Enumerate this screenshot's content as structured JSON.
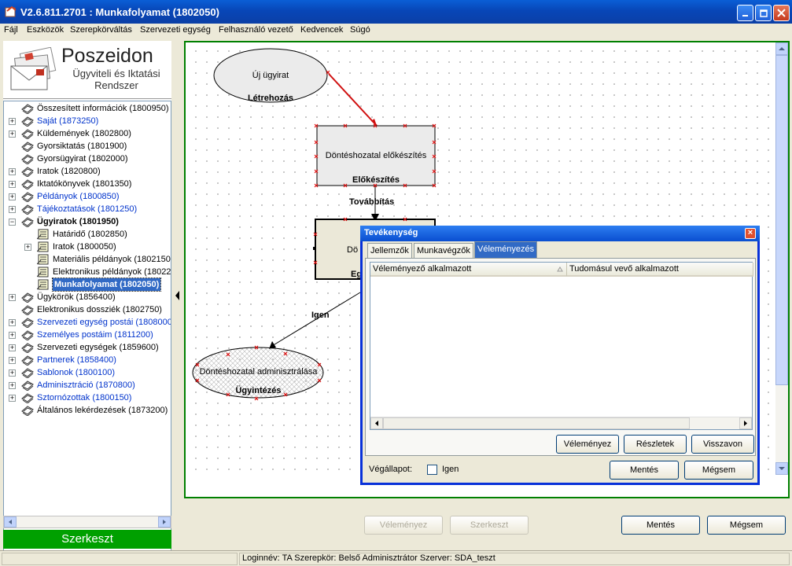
{
  "window": {
    "title": "V2.6.811.2701 : Munkafolyamat (1802050)"
  },
  "menu": [
    "Fájl",
    "Eszközök",
    "Szerepkörváltás",
    "Szervezeti egység",
    "Felhasználó vezető",
    "Kedvencek",
    "Súgó"
  ],
  "logo": {
    "brand": "Poszeidon",
    "line1": "Ügyviteli és Iktatási",
    "line2": "Rendszer"
  },
  "tree": [
    {
      "label": "Összesített információk (1800950)"
    },
    {
      "label": "Saját (1873250)"
    },
    {
      "label": "Küldemények (1802800)"
    },
    {
      "label": "Gyorsiktatás (1801900)"
    },
    {
      "label": "Gyorsügyirat (1802000)"
    },
    {
      "label": "Iratok (1820800)"
    },
    {
      "label": "Iktatókönyvek (1801350)"
    },
    {
      "label": "Példányok (1800850)"
    },
    {
      "label": "Tájékoztatások (1801250)"
    },
    {
      "label": "Ügyiratok (1801950)"
    },
    {
      "label": "Határidő (1802850)"
    },
    {
      "label": "Iratok (1800050)"
    },
    {
      "label": "Materiális példányok (1802150)"
    },
    {
      "label": "Elektronikus példányok (180220"
    },
    {
      "label": "Munkafolyamat (1802050)"
    },
    {
      "label": "Ügykörök (1856400)"
    },
    {
      "label": "Elektronikus dossziék (1802750)"
    },
    {
      "label": "Szervezeti egység postái (1808000)"
    },
    {
      "label": "Személyes postáim (1811200)"
    },
    {
      "label": "Szervezeti egységek (1859600)"
    },
    {
      "label": "Partnerek (1858400)"
    },
    {
      "label": "Sablonok (1800100)"
    },
    {
      "label": "Adminisztráció (1870800)"
    },
    {
      "label": "Sztornózottak (1800150)"
    },
    {
      "label": "Általános lekérdezések (1873200)"
    }
  ],
  "left_footer": "Szerkeszt",
  "workflow": {
    "nodes": [
      {
        "label": "Új ügyirat",
        "caption": "Létrehozás"
      },
      {
        "label": "Döntéshozatal előkészítés",
        "caption": "Előkészítés"
      },
      {
        "label": "Dö",
        "caption": "Eg"
      },
      {
        "label": "Döntéshozatal adminisztrálása",
        "caption": "Ügyintézés"
      }
    ],
    "edges": [
      "Továbbítás",
      "Igen"
    ]
  },
  "dialog": {
    "title": "Tevékenység",
    "tabs": [
      "Jellemzők",
      "Munkavégzők",
      "Véleményezés"
    ],
    "columns": [
      "Véleményező alkalmazott",
      "Tudomásul vevő alkalmazott"
    ],
    "buttons": {
      "opinion": "Véleményez",
      "details": "Részletek",
      "withdraw": "Visszavon"
    },
    "final_state_label": "Végállapot:",
    "final_state_checkbox": "Igen",
    "final_state_checked": false,
    "save": "Mentés",
    "cancel": "Mégsem"
  },
  "bottom_buttons": {
    "opinion": "Véleményez",
    "edit": "Szerkeszt",
    "save": "Mentés",
    "cancel": "Mégsem"
  },
  "status": "Loginnév: TA   Szerepkör: Belső Adminisztrátor   Szerver: SDA_teszt",
  "colors": {
    "title_bar": "#0a52d0",
    "selection": "#316ac5",
    "link_blue": "#0033cc",
    "canvas_border": "#008000",
    "edit_bar": "#00a000",
    "connector_red": "#d01010"
  }
}
